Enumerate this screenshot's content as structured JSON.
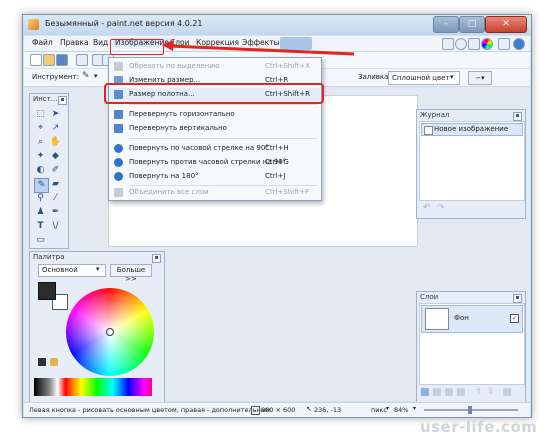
{
  "window": {
    "title": "Безымянный - paint.net версия 4.0.21"
  },
  "menubar": {
    "items": [
      "Файл",
      "Правка",
      "Вид",
      "Изображение",
      "Слои",
      "Коррекция",
      "Эффекты"
    ]
  },
  "toolbar2": {
    "tool_label": "Инструмент:",
    "fill_label": "Заливка:",
    "fill_value": "Сплошной цвет"
  },
  "image_menu": {
    "items": [
      {
        "label": "Обрезать по выделению",
        "shortcut": "Ctrl+Shift+X",
        "disabled": true,
        "icon": "crop-icon"
      },
      {
        "label": "Изменить размер...",
        "shortcut": "Ctrl+R",
        "disabled": false,
        "icon": "resize-icon"
      },
      {
        "label": "Размер полотна...",
        "shortcut": "Ctrl+Shift+R",
        "disabled": false,
        "icon": "canvas-size-icon",
        "highlighted": true
      },
      {
        "label": "Перевернуть горизонтально",
        "shortcut": "",
        "disabled": false,
        "icon": "flip-horizontal-icon"
      },
      {
        "label": "Перевернуть вертикально",
        "shortcut": "",
        "disabled": false,
        "icon": "flip-vertical-icon"
      },
      {
        "label": "Повернуть по часовой стрелке на 90°",
        "shortcut": "Ctrl+H",
        "disabled": false,
        "icon": "rotate-cw-icon"
      },
      {
        "label": "Повернуть против часовой стрелки на 90°",
        "shortcut": "Ctrl+G",
        "disabled": false,
        "icon": "rotate-ccw-icon"
      },
      {
        "label": "Повернуть на 180°",
        "shortcut": "Ctrl+J",
        "disabled": false,
        "icon": "rotate-180-icon"
      },
      {
        "label": "Объединить все слои",
        "shortcut": "Ctrl+Shift+F",
        "disabled": true,
        "icon": "flatten-icon"
      }
    ]
  },
  "tools_panel": {
    "title": "Инст..."
  },
  "history_panel": {
    "title": "Журнал",
    "items": [
      "Новое изображение"
    ]
  },
  "palette_panel": {
    "title": "Палитра",
    "mode": "Основной",
    "more_button": "Больше >>"
  },
  "layers_panel": {
    "title": "Слои",
    "layers": [
      "Фон"
    ]
  },
  "statusbar": {
    "hint": "Левая кнопка - рисовать основным цветом, правая - дополнительным.",
    "size": "800 × 600",
    "coords": "236, -13",
    "unit": "пикс",
    "zoom": "84%"
  },
  "watermark": "user-life.com",
  "colors": {
    "accent_red": "#e0261f",
    "window_frame": "#cfe0f2",
    "menu_bg": "#f7f9fc"
  }
}
